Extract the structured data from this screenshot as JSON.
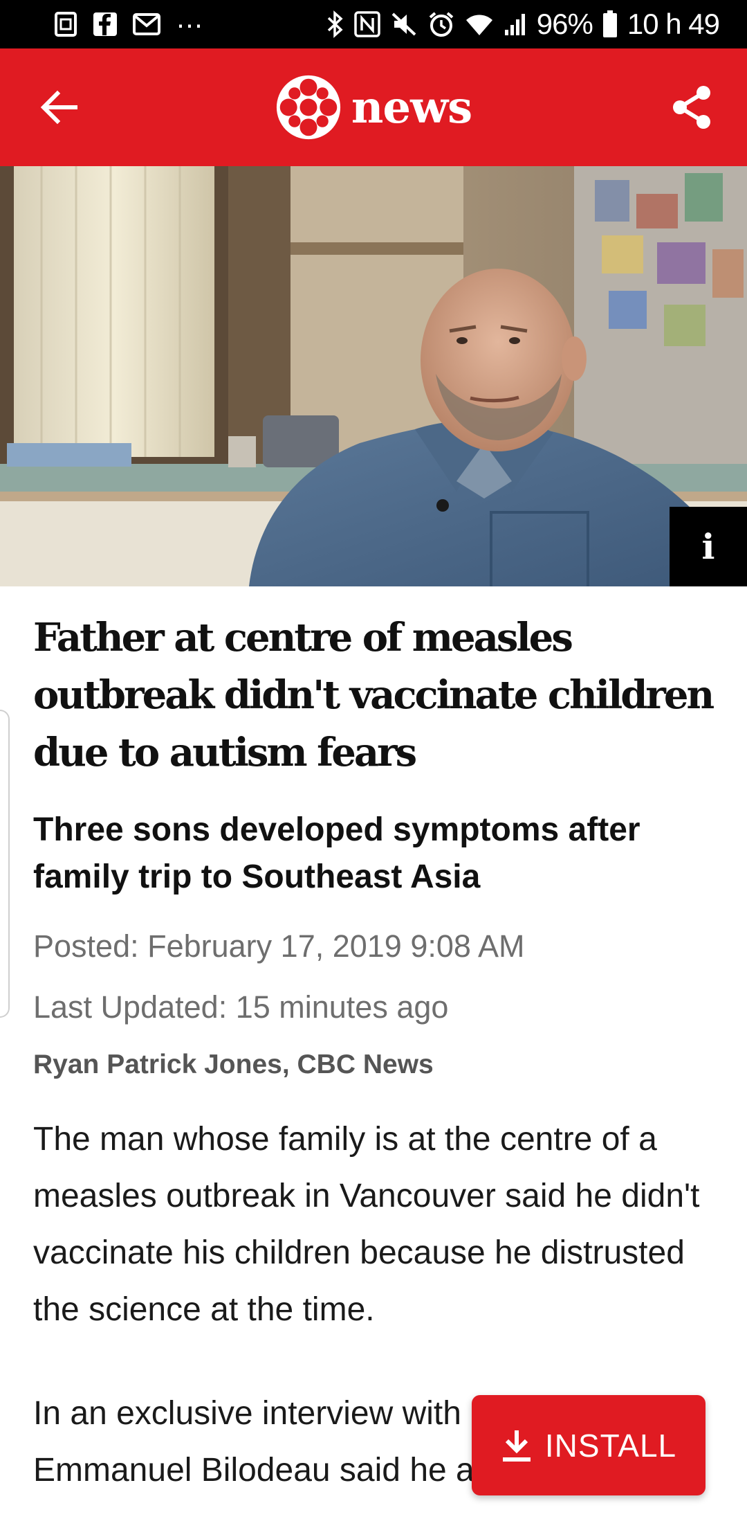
{
  "status_bar": {
    "battery_percent": "96%",
    "time": "10 h 49",
    "overflow": "···",
    "icons": [
      "sim-icon",
      "facebook-icon",
      "mail-icon",
      "bluetooth-icon",
      "nfc-icon",
      "mute-icon",
      "alarm-icon",
      "wifi-icon",
      "signal-icon",
      "battery-icon"
    ]
  },
  "app_bar": {
    "brand": "news",
    "back_icon": "arrow-left-icon",
    "share_icon": "share-icon",
    "logo_icon": "cbc-gem-icon",
    "background_color": "#e01b22"
  },
  "hero": {
    "info_label": "i"
  },
  "article": {
    "headline": "Father at centre of measles outbreak didn't vaccinate children due to autism fears",
    "subhead": "Three sons developed symptoms after family trip to Southeast Asia",
    "posted": "Posted: February 17, 2019 9:08 AM",
    "updated": "Last Updated: 15 minutes ago",
    "byline": "Ryan Patrick Jones, CBC News",
    "paragraphs": [
      "The man whose family is at the centre of a measles outbreak in Vancouver said he didn't vaccinate his children because he distrusted the science at the time.",
      "In an exclusive interview with CBC News, Emmanuel Bilodeau said he and his"
    ]
  },
  "install_button": {
    "label": "INSTALL",
    "icon": "download-icon"
  }
}
